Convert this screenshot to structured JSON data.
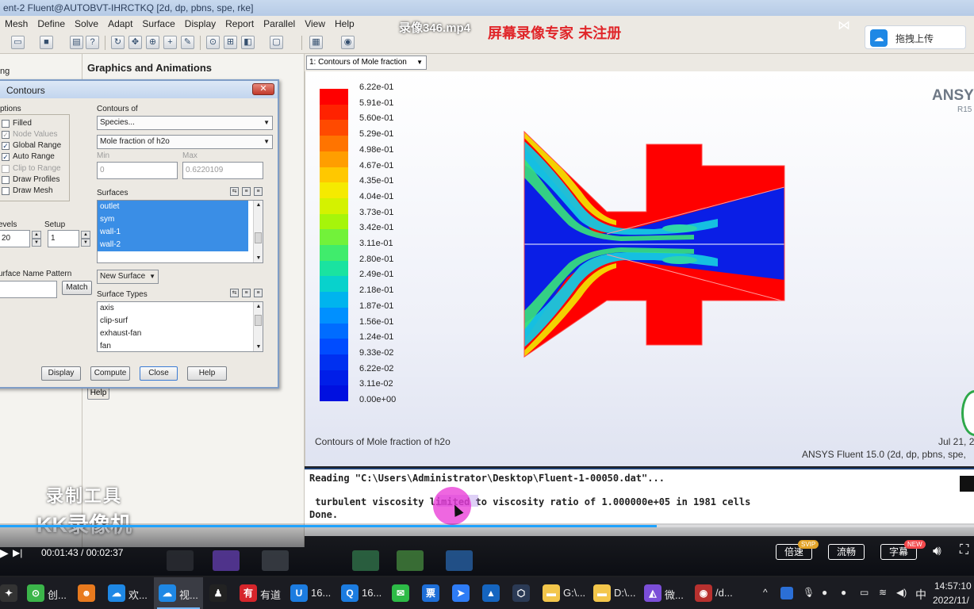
{
  "fluent": {
    "window_title": "ent-2 Fluent@AUTOBVT-IHRCTKQ  [2d, dp, pbns, spe, rke]",
    "menu": [
      "Mesh",
      "Define",
      "Solve",
      "Adapt",
      "Surface",
      "Display",
      "Report",
      "Parallel",
      "View",
      "Help"
    ],
    "left_pane_text": "ng",
    "panel_heading": "Graphics and Animations",
    "panel_help_label": "Help"
  },
  "dialog": {
    "title": "Contours",
    "options_label": "ptions",
    "options": [
      {
        "label": "Filled",
        "checked": false,
        "enabled": true
      },
      {
        "label": "Node Values",
        "checked": true,
        "enabled": false
      },
      {
        "label": "Global Range",
        "checked": true,
        "enabled": true
      },
      {
        "label": "Auto Range",
        "checked": true,
        "enabled": true
      },
      {
        "label": "Clip to Range",
        "checked": false,
        "enabled": false
      },
      {
        "label": "Draw Profiles",
        "checked": false,
        "enabled": true
      },
      {
        "label": "Draw Mesh",
        "checked": false,
        "enabled": true
      }
    ],
    "contours_of_label": "Contours of",
    "contours_category": "Species...",
    "contours_variable": "Mole fraction of h2o",
    "min_label": "Min",
    "max_label": "Max",
    "min_value": "0",
    "max_value": "0.6220109",
    "levels_label": "evels",
    "levels_value": "20",
    "setup_label": "Setup",
    "setup_value": "1",
    "surfaces_label": "Surfaces",
    "surfaces": [
      {
        "name": "outlet",
        "selected": true
      },
      {
        "name": "sym",
        "selected": true
      },
      {
        "name": "wall-1",
        "selected": true
      },
      {
        "name": "wall-2",
        "selected": true
      }
    ],
    "surface_name_pattern_label": "urface Name Pattern",
    "match_label": "Match",
    "new_surface_label": "New Surface",
    "surface_types_label": "Surface Types",
    "surface_types": [
      "axis",
      "clip-surf",
      "exhaust-fan",
      "fan"
    ],
    "buttons": {
      "display": "Display",
      "compute": "Compute",
      "close": "Close",
      "help": "Help"
    }
  },
  "graphics": {
    "window_select": "1: Contours of Mole fraction",
    "logo": "ANSYS",
    "logo_version": "R15",
    "caption": "Contours of Mole fraction of h2o",
    "date": "Jul 21, 2",
    "info": "ANSYS Fluent 15.0 (2d, dp, pbns, spe,",
    "colorbar_labels": [
      "6.22e-01",
      "5.91e-01",
      "5.60e-01",
      "5.29e-01",
      "4.98e-01",
      "4.67e-01",
      "4.35e-01",
      "4.04e-01",
      "3.73e-01",
      "3.42e-01",
      "3.11e-01",
      "2.80e-01",
      "2.49e-01",
      "2.18e-01",
      "1.87e-01",
      "1.56e-01",
      "1.24e-01",
      "9.33e-02",
      "6.22e-02",
      "3.11e-02",
      "0.00e+00"
    ],
    "colorbar_colors": [
      "#ff0000",
      "#ff2200",
      "#ff4a00",
      "#ff7400",
      "#ff9e00",
      "#ffc800",
      "#f5ea00",
      "#d4f200",
      "#a6f50a",
      "#72f23a",
      "#40ec6c",
      "#1ae3a0",
      "#08d2cc",
      "#00b4ee",
      "#0090ff",
      "#006cff",
      "#004cff",
      "#0030f0",
      "#001ee8",
      "#0010e0"
    ]
  },
  "console": {
    "lines": [
      "Reading \"C:\\Users\\Administrator\\Desktop\\Fluent-1-00050.dat\"...",
      "",
      " turbulent viscosity limited to viscosity ratio of 1.000000e+05 in 1981 cells",
      "Done."
    ]
  },
  "player": {
    "video_title": "录像346.mp4",
    "watermark_top": "屏幕录像专家  未注册",
    "upload_label": "拖拽上传",
    "recorder_line1": "录制工具",
    "recorder_line2": "KK录像机",
    "time": "00:01:43 / 00:02:37",
    "progress": 0.674,
    "speed_label": "倍速",
    "speed_badge": "SVIP",
    "quality_label": "流畅",
    "subtitle_label": "字幕",
    "subtitle_badge": "NEW"
  },
  "taskbar": {
    "apps": [
      {
        "icon": "green-circle-icon",
        "label": "创...",
        "color": "#3bb54a"
      },
      {
        "icon": "monkey-icon",
        "label": "",
        "color": "#e87a1e"
      },
      {
        "icon": "cloud-icon",
        "label": "欢...",
        "color": "#1e88e5"
      },
      {
        "icon": "cloud-icon",
        "label": "视...",
        "color": "#1e88e5"
      },
      {
        "icon": "penguin-icon",
        "label": "",
        "color": "#222222"
      },
      {
        "icon": "youdao-icon",
        "label": "有道",
        "color": "#d6252b"
      },
      {
        "icon": "u-icon",
        "label": "16...",
        "color": "#1c7ce0"
      },
      {
        "icon": "q-icon",
        "label": "16...",
        "color": "#1c7ce0"
      },
      {
        "icon": "wechat-icon",
        "label": "",
        "color": "#2dbb47"
      },
      {
        "icon": "ticket-icon",
        "label": "",
        "color": "#1e6fd8"
      },
      {
        "icon": "feishu-icon",
        "label": "",
        "color": "#2e7cf6"
      },
      {
        "icon": "lanhu-icon",
        "label": "",
        "color": "#1565c0"
      },
      {
        "icon": "cube-icon",
        "label": "",
        "color": "#2b3a55"
      },
      {
        "icon": "folder-icon",
        "label": "G:\\...",
        "color": "#f3c64b"
      },
      {
        "icon": "folder-icon",
        "label": "D:\\...",
        "color": "#f3c64b"
      },
      {
        "icon": "chart-icon",
        "label": "微...",
        "color": "#7b4ed8"
      },
      {
        "icon": "fluent-icon",
        "label": "/d...",
        "color": "#b8312f"
      }
    ],
    "ime": "中",
    "clock_time": "14:57:10",
    "clock_date": "2022/11/"
  }
}
